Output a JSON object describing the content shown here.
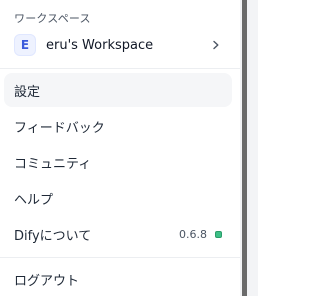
{
  "menu": {
    "section_label": "ワークスペース",
    "workspace": {
      "avatar_letter": "E",
      "name": "eru's Workspace",
      "chevron_icon": "chevron-right-icon"
    },
    "items": [
      {
        "label": "設定"
      },
      {
        "label": "フィードバック"
      },
      {
        "label": "コミュニティ"
      },
      {
        "label": "ヘルプ"
      },
      {
        "label": "Difyについて",
        "version": "0.6.8",
        "status_color": "#3dbf86"
      }
    ],
    "logout_label": "ログアウト"
  }
}
